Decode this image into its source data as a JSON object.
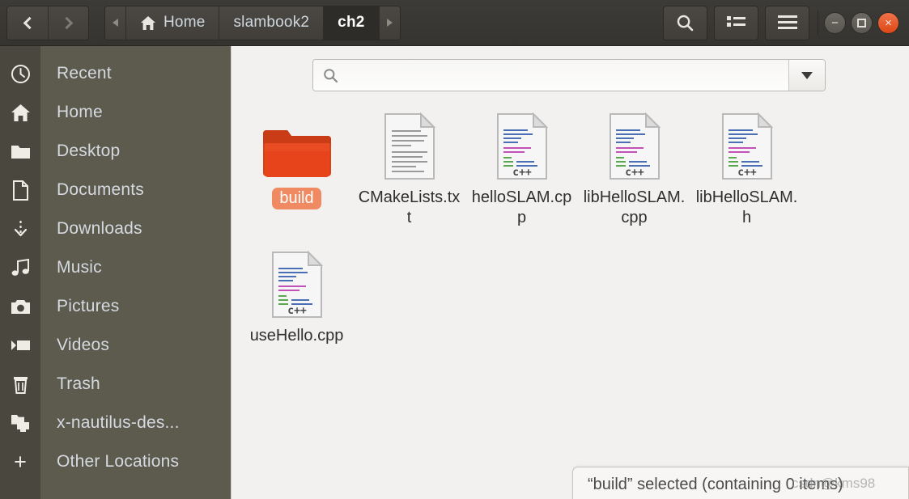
{
  "window": {
    "titlebar_buttons": [
      {
        "name": "minimize",
        "glyph": "−"
      },
      {
        "name": "maximize",
        "glyph": "□"
      },
      {
        "name": "close",
        "glyph": "×",
        "color": "#dd4814"
      }
    ]
  },
  "toolbar": {
    "back_label": "Back",
    "forward_label": "Forward",
    "breadcrumbs": [
      {
        "label": "Home",
        "icon": "home-icon",
        "active": false
      },
      {
        "label": "slambook2",
        "icon": "",
        "active": false
      },
      {
        "label": "ch2",
        "icon": "",
        "active": true
      }
    ],
    "crumb_prev_arrow": "◂",
    "crumb_next_arrow": "▸",
    "search_label": "Search",
    "view_toggle_label": "View options",
    "menu_label": "Menu"
  },
  "sidebar": {
    "items": [
      {
        "label": "Recent",
        "icon": "clock-icon"
      },
      {
        "label": "Home",
        "icon": "home-icon"
      },
      {
        "label": "Desktop",
        "icon": "folder-icon"
      },
      {
        "label": "Documents",
        "icon": "document-icon"
      },
      {
        "label": "Downloads",
        "icon": "download-icon"
      },
      {
        "label": "Music",
        "icon": "music-icon"
      },
      {
        "label": "Pictures",
        "icon": "camera-icon"
      },
      {
        "label": "Videos",
        "icon": "video-icon"
      },
      {
        "label": "Trash",
        "icon": "trash-icon"
      },
      {
        "label": "x-nautilus-des...",
        "icon": "network-folder-icon"
      },
      {
        "label": "Other Locations",
        "icon": "plus-icon"
      }
    ]
  },
  "search": {
    "value": "",
    "placeholder": "",
    "dropdown_label": "Search options"
  },
  "files": [
    {
      "name": "build",
      "type": "folder",
      "selected": true
    },
    {
      "name": "CMakeLists.txt",
      "type": "text"
    },
    {
      "name": "helloSLAM.cpp",
      "type": "cpp"
    },
    {
      "name": "libHelloSLAM.cpp",
      "type": "cpp"
    },
    {
      "name": "libHelloSLAM.h",
      "type": "cpp"
    },
    {
      "name": "useHello.cpp",
      "type": "cpp"
    }
  ],
  "file_icon_badge": "c++",
  "statusbar": {
    "text": "“build” selected (containing 0 items)"
  },
  "watermark": {
    "text": "csdn@kms98"
  },
  "colors": {
    "toolbar": "#3d3b37",
    "sidebar": "#5d5a4e",
    "sidebar_rail": "#4a473e",
    "content": "#f2f1ef",
    "selection": "#f08a62",
    "folder": "#dd4814",
    "close_button": "#dd4814"
  }
}
